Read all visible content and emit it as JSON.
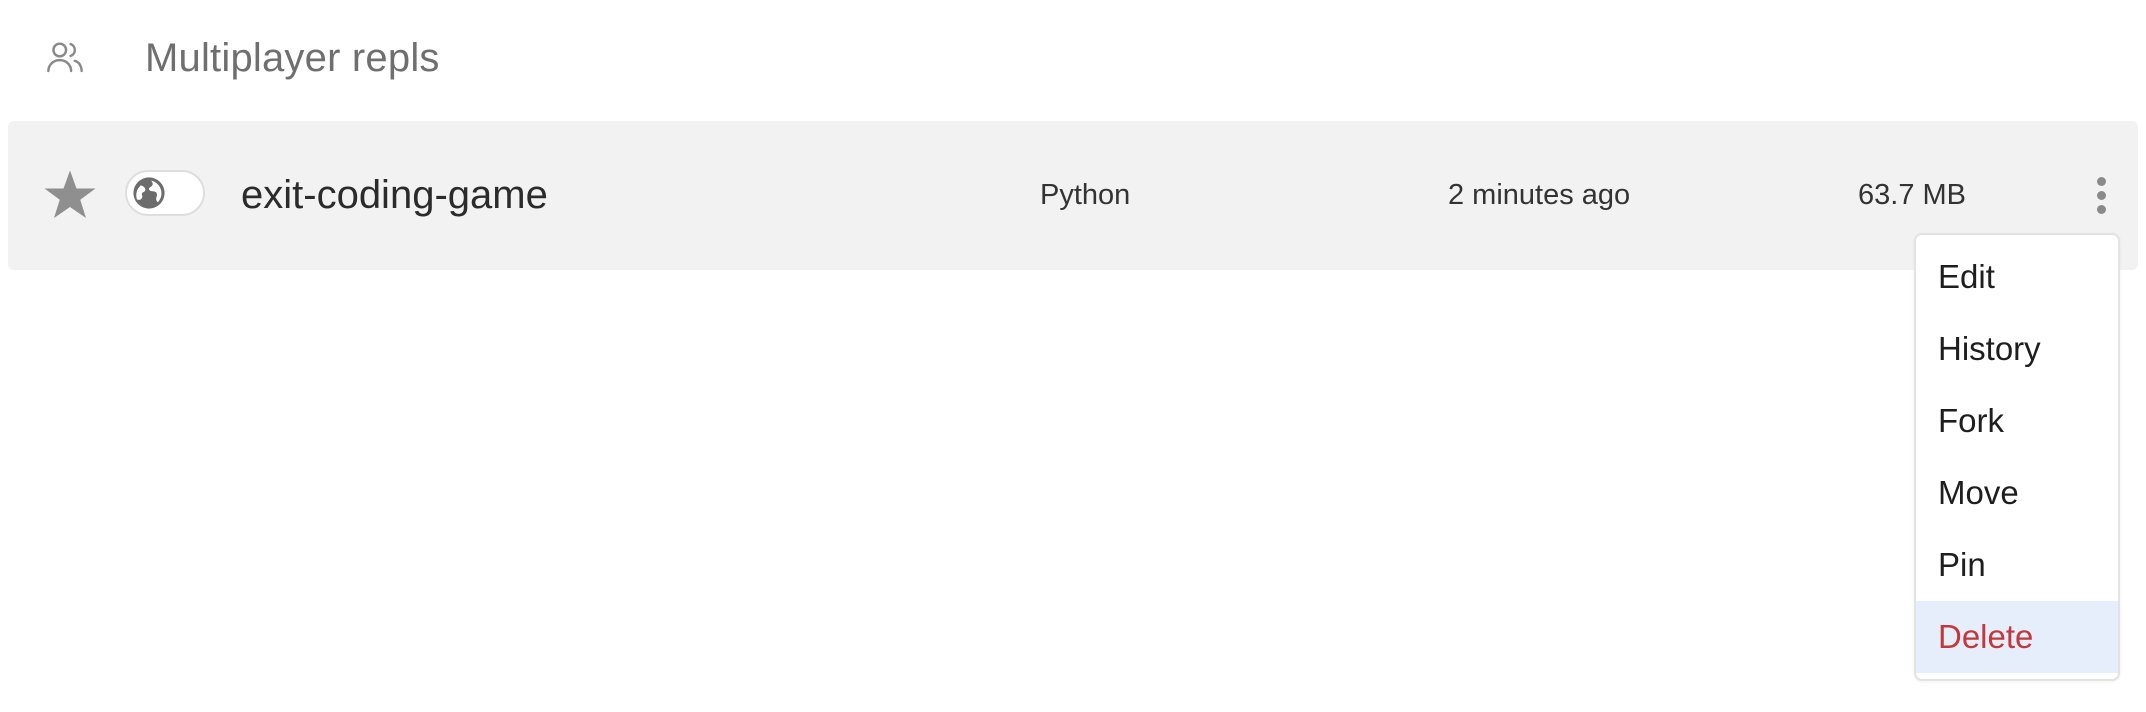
{
  "section": {
    "icon": "users-icon",
    "title": "Multiplayer repls"
  },
  "repl": {
    "starred_icon": "star-icon",
    "privacy_icon": "globe-icon",
    "name": "exit-coding-game",
    "language": "Python",
    "modified": "2 minutes ago",
    "size": "63.7 MB",
    "more_icon": "more-vertical-icon"
  },
  "menu": {
    "items": [
      {
        "label": "Edit"
      },
      {
        "label": "History"
      },
      {
        "label": "Fork"
      },
      {
        "label": "Move"
      },
      {
        "label": "Pin"
      },
      {
        "label": "Delete",
        "highlighted": true
      }
    ],
    "danger_color": "#c1393b",
    "highlight_color": "#e5eefa"
  },
  "colors": {
    "row_background": "#f2f2f2",
    "muted_text": "#6f6f6f"
  }
}
